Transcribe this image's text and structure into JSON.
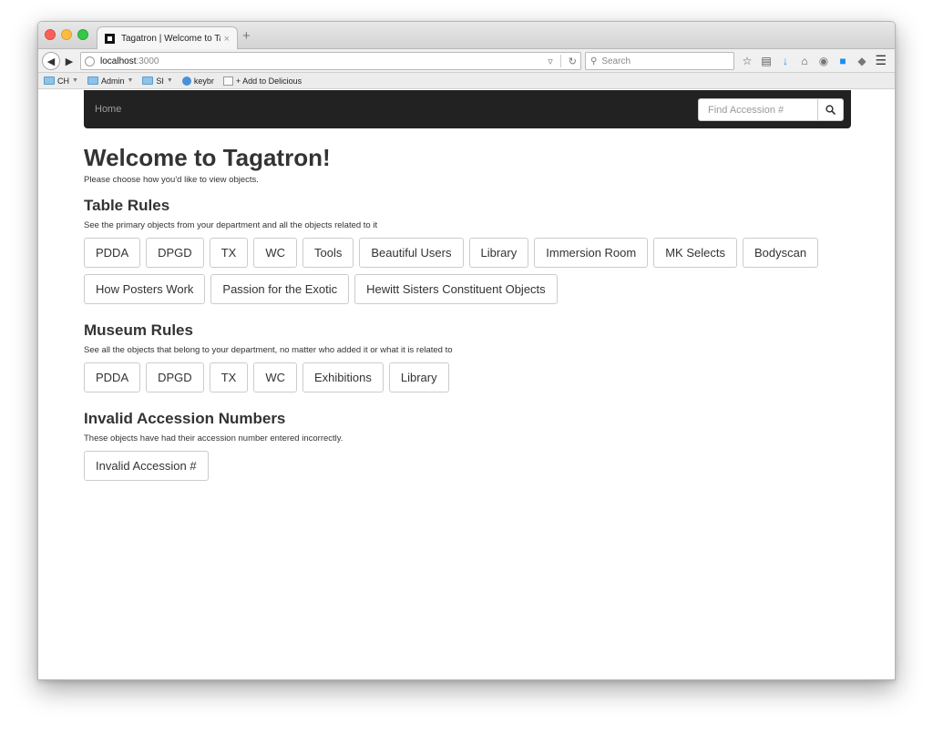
{
  "browser": {
    "tab_title": "Tagatron | Welcome to Tag...",
    "tab_close": "×",
    "new_tab": "+",
    "url_host": "localhost",
    "url_port": ":3000",
    "search_placeholder": "Search",
    "bookmarks": [
      {
        "label": "CH"
      },
      {
        "label": "Admin"
      },
      {
        "label": "SI"
      },
      {
        "label": "keybr"
      },
      {
        "label": "+ Add to Delicious"
      }
    ]
  },
  "site": {
    "brand": "Home",
    "find_placeholder": "Find Accession #"
  },
  "page": {
    "title": "Welcome to Tagatron!",
    "subtitle": "Please choose how you'd like to view objects."
  },
  "sections": {
    "table_rules": {
      "title": "Table Rules",
      "desc": "See the primary objects from your department and all the objects related to it",
      "buttons": [
        "PDDA",
        "DPGD",
        "TX",
        "WC",
        "Tools",
        "Beautiful Users",
        "Library",
        "Immersion Room",
        "MK Selects",
        "Bodyscan",
        "How Posters Work",
        "Passion for the Exotic",
        "Hewitt Sisters Constituent Objects"
      ]
    },
    "museum_rules": {
      "title": "Museum Rules",
      "desc": "See all the objects that belong to your department, no matter who added it or what it is related to",
      "buttons": [
        "PDDA",
        "DPGD",
        "TX",
        "WC",
        "Exhibitions",
        "Library"
      ]
    },
    "invalid": {
      "title": "Invalid Accession Numbers",
      "desc": "These objects have had their accession number entered incorrectly.",
      "buttons": [
        "Invalid Accession #"
      ]
    }
  }
}
